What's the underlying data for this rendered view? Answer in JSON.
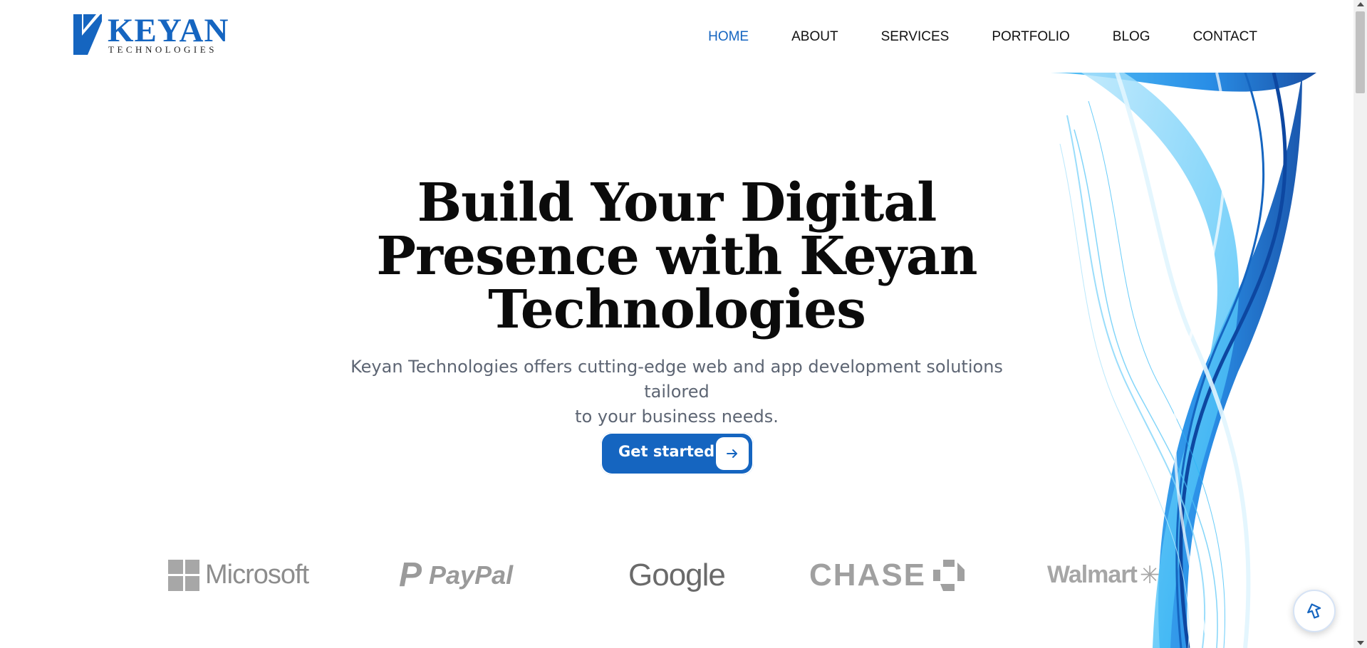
{
  "brand": {
    "name": "KEYAN",
    "tagline": "TECHNOLOGIES"
  },
  "nav": {
    "items": [
      {
        "label": "HOME",
        "active": true
      },
      {
        "label": "ABOUT"
      },
      {
        "label": "SERVICES"
      },
      {
        "label": "PORTFOLIO"
      },
      {
        "label": "BLOG"
      },
      {
        "label": "CONTACT"
      }
    ]
  },
  "hero": {
    "title_line1": "Build Your Digital",
    "title_line2": "Presence with Keyan",
    "title_line3": "Technologies",
    "subtitle_line1": "Keyan Technologies offers cutting-edge web and app development solutions tailored",
    "subtitle_line2": "to your business needs.",
    "cta_label": "Get started",
    "cta_icon": "arrow-right-icon"
  },
  "partners": [
    {
      "name": "Microsoft",
      "icon": "microsoft-logo"
    },
    {
      "name": "PayPal",
      "icon": "paypal-logo"
    },
    {
      "name": "Google",
      "icon": "google-logo"
    },
    {
      "name": "CHASE",
      "icon": "chase-logo"
    },
    {
      "name": "Walmart",
      "icon": "walmart-logo"
    }
  ],
  "chat": {
    "icon": "chat-launcher-icon"
  },
  "colors": {
    "accent": "#1565c0",
    "text": "#0b0b0b",
    "muted": "#5d6573"
  }
}
